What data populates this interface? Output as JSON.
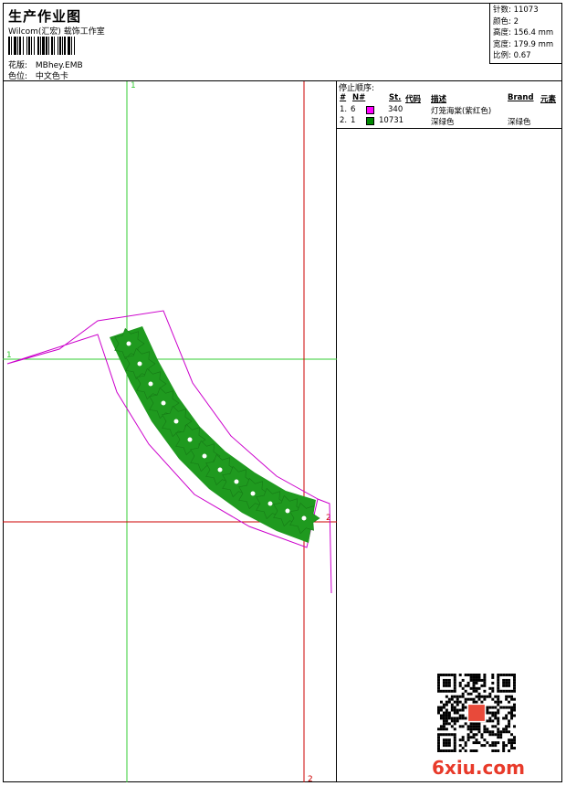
{
  "header": {
    "title": "生产作业图",
    "company": "Wilcom(汇宏) 载饰工作室",
    "design_file_label": "花版:",
    "design_file": "MBhey.EMB",
    "color_chart_label": "色位:",
    "color_chart": "中文色卡"
  },
  "specs": [
    {
      "label": "针数:",
      "value": "11073"
    },
    {
      "label": "颜色:",
      "value": "2"
    },
    {
      "label": "高度:",
      "value": "156.4 mm"
    },
    {
      "label": "宽度:",
      "value": "179.9 mm"
    },
    {
      "label": "比例:",
      "value": "0.67"
    }
  ],
  "legend": {
    "heading": "停止顺序:",
    "columns": {
      "num": "#",
      "n": "N#",
      "st": "St.",
      "code": "代码",
      "desc": "描述",
      "brand": "Brand",
      "element": "元素"
    },
    "rows": [
      {
        "num": "1.",
        "n": "6",
        "color": "#ff00ff",
        "st": "340",
        "desc": "灯笼海棠(紫红色)",
        "brand": ""
      },
      {
        "num": "2.",
        "n": "1",
        "color": "#008800",
        "st": "10731",
        "desc": "深绿色",
        "brand": "深绿色"
      }
    ]
  },
  "markers": {
    "green_left": "1",
    "green_top": "1",
    "red_right": "2",
    "red_bottom": "2"
  },
  "colors": {
    "outline": "#cc00cc",
    "fill": "#1f9a1f",
    "green_guide": "#33cc33",
    "red_guide": "#cc0000"
  },
  "watermark": "6xiu.com"
}
